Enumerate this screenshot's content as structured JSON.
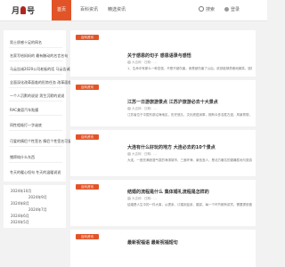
{
  "header": {
    "logo_left": "月",
    "logo_right": "号",
    "nav": [
      "首页",
      "百科资讯",
      "精选资讯"
    ],
    "search_label": "搜索",
    "login_label": "登录",
    "accent": "#e25427"
  },
  "sidebar": {
    "links": [
      "男士质感十足的网名",
      "名家写给妈妈的 最有触动的名言名句",
      "马云告诫2020公司老板的话 马云告诫2020公司老板",
      "全面深化改革面临的形势任务 改革面临的新形势新",
      "一个人沉默的说说 男生沉默的说说",
      "RAC美容汽车贴膜",
      "同性相吸打一字谜底",
      "可爱的情侣个性签名 情侣个性签名可爱",
      "猪蹄炖什么东西",
      "冬天的暖心短句 冬天的温暖说说"
    ]
  },
  "archive": {
    "items": [
      "2024年10月",
      "2024年9月",
      "2024年8月",
      "2024年7月",
      "2024年6月",
      "2024年5月"
    ]
  },
  "posts": [
    {
      "badge": "百科资讯",
      "title": "关于感恩的句子 感恩语录与感悟",
      "meta": "大吉网  · 日期：...",
      "excerpt": "1、生命中有那么一种坚强，不是不被伤害，而是被伤害了以后，依然能够勇敢地微笑，感恩一切给予的美好..."
    },
    {
      "badge": "百科资讯",
      "title": "江苏一日游旅游景点 江苏沪旅游必去十大景点",
      "meta": "大吉网  · 日期：...",
      "excerpt": "江苏省位于中国东部沿海地区，历史悠久，文化底蕴深厚，拥有众多名胜古迹，风景秀丽，值得一游..."
    },
    {
      "badge": "百科资讯",
      "title": "大连有什么好玩的地方 大连必去的10个景点",
      "meta": "大吉网  · 日期：...",
      "excerpt": "大连，一座充满浪漫气息的海滨城市，三面环海，景色宜人，是北方著名的避暑胜地与旅游城市..."
    },
    {
      "badge": "百科资讯",
      "title": "结婚的流程是什么 集体婚礼流程是怎样的",
      "meta": "大吉网  · 日期：...",
      "excerpt": "结婚是人生中的一件大事，从提亲、订婚到迎亲、婚宴，每一个环节都有讲究，需要提前做好准备..."
    },
    {
      "badge": "百科资讯",
      "title": "最新祝福语 最新祝福短句",
      "meta": "",
      "excerpt": ""
    }
  ],
  "colors": {
    "accent": "#e25427",
    "logo_mark": "#b0261c"
  }
}
